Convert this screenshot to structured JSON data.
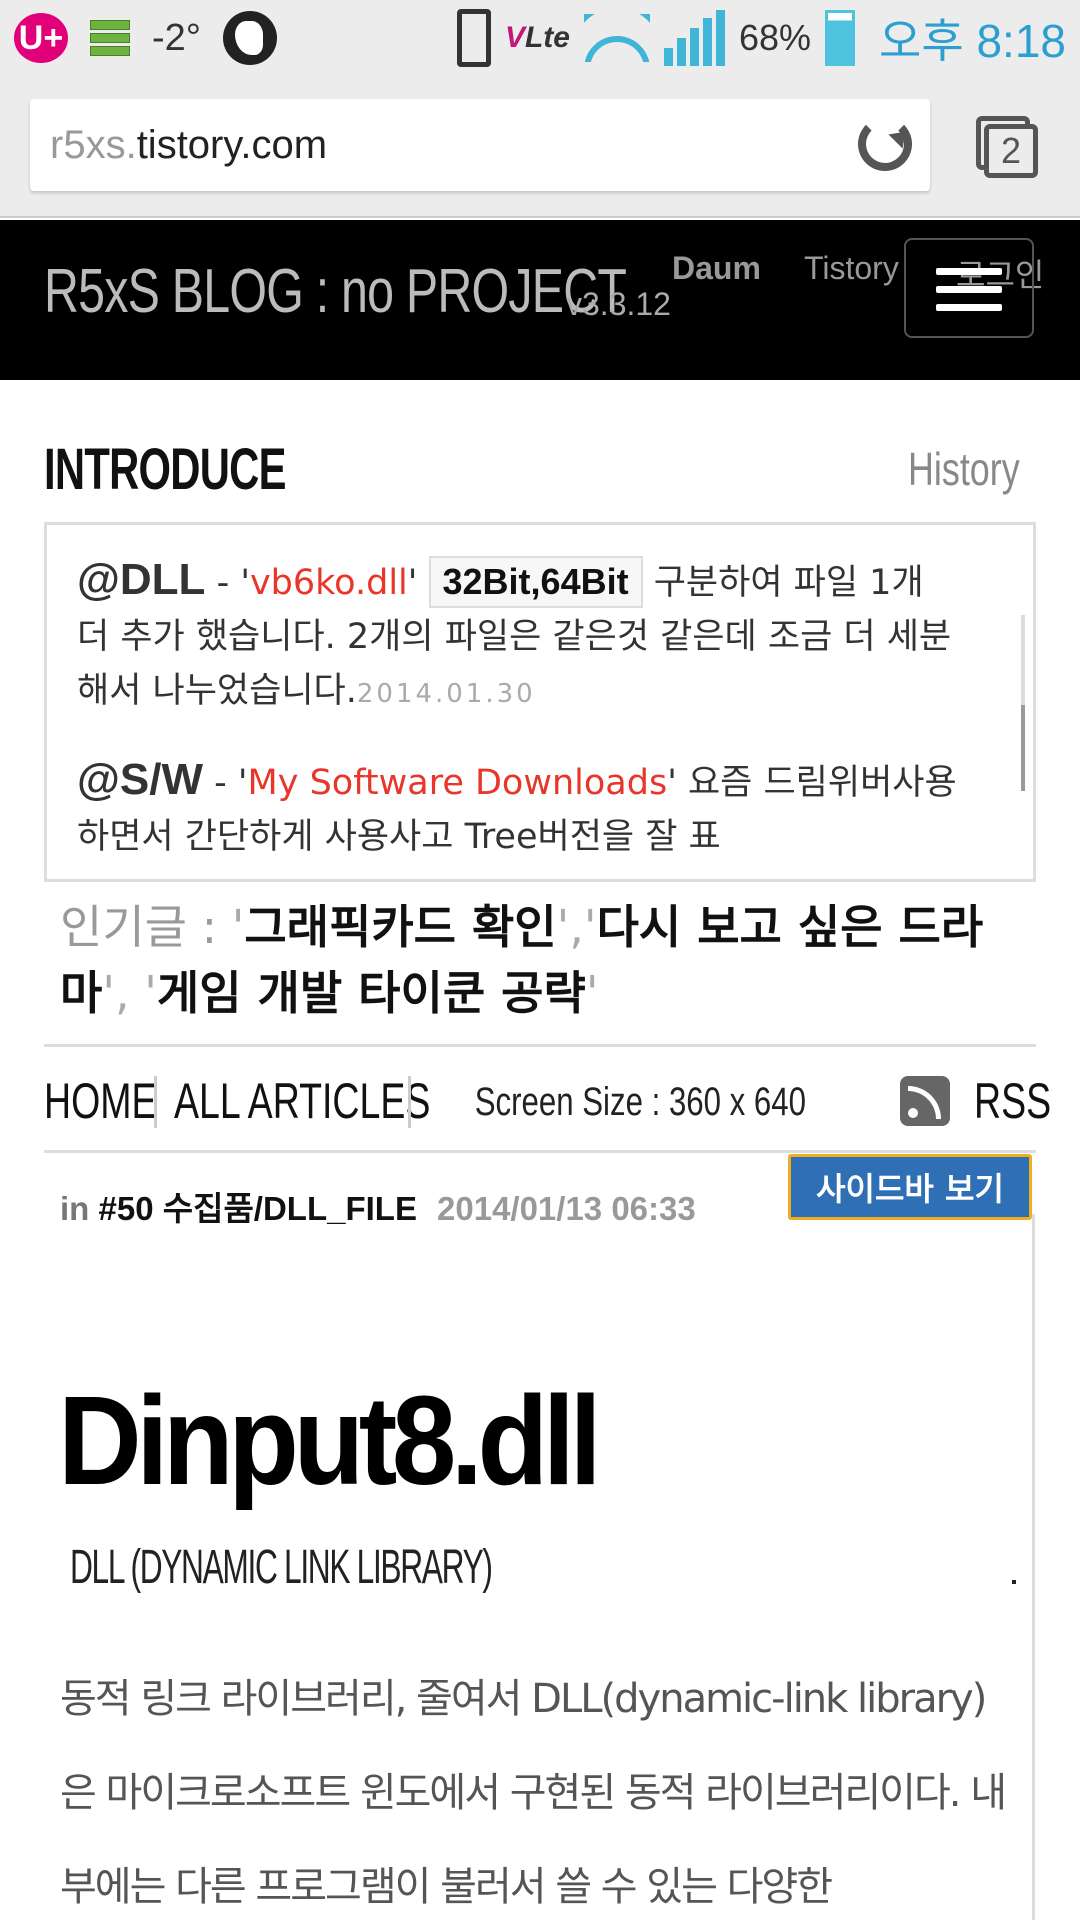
{
  "status_bar": {
    "carrier_logo": "U+",
    "temperature": "-2°",
    "network": "Lte",
    "network_prefix": "V",
    "battery_percent": "68%",
    "battery_level": 0.68,
    "time": "오후 8:18"
  },
  "browser": {
    "url_subdomain": "r5xs.",
    "url_domain": "tistory.com",
    "tab_count": "2"
  },
  "blog_header": {
    "title": "R5xS BLOG : no PROJECT",
    "version": "v3.3.12",
    "links": [
      "Daum",
      "Tistory",
      "로그인"
    ]
  },
  "introduce": {
    "title": "INTRODUCE",
    "history_link": "History",
    "items": [
      {
        "tag": "@DLL",
        "dash": " - '",
        "highlight": "vb6ko.dll",
        "quote_close": "' ",
        "badge": "32Bit,64Bit",
        "text": " 구분하여 파일 1개 더 추가 했습니다. 2개의 파일은 같은것 같은데 조금 더 세분해서 나누었습니다.",
        "date": "2014.01.30"
      },
      {
        "tag": "@S/W",
        "dash": " - '",
        "highlight": "My Software Downloads",
        "quote_close": "'",
        "text": " 요즘 드림위버사용하면서 간단하게 사용사고 Tree버전을 잘 표"
      }
    ]
  },
  "popular": {
    "label": "인기글 : ",
    "items": [
      "그래픽카드 확인",
      "다시 보고 싶은 드라마",
      "게임 개발 타이쿤 공략"
    ]
  },
  "nav": {
    "home": "HOME",
    "all_articles": "ALL ARTICLES",
    "screen_size": "Screen Size : 360 x 640",
    "rss": "RSS"
  },
  "post": {
    "meta_in": "in ",
    "meta_category": "#50 수집품/DLL_FILE",
    "meta_date": "2014/01/13 06:33",
    "sidebar_button": "사이드바 보기",
    "title": "Dinput8.dll",
    "subtitle": "DLL (DYNAMIC LINK LIBRARY)",
    "body": "동적 링크 라이브러리, 줄여서 DLL(dynamic-link library)은 마이크로소프트 윈도에서 구현된 동적 라이브러리이다. 내부에는 다른 프로그램이 불러서 쓸 수 있는 다양한"
  },
  "colors": {
    "accent_red": "#e8362a",
    "sidebar_button_bg": "#2e6fb5",
    "sidebar_button_border": "#f0ad1e",
    "clock_blue": "#2a9fd0"
  }
}
